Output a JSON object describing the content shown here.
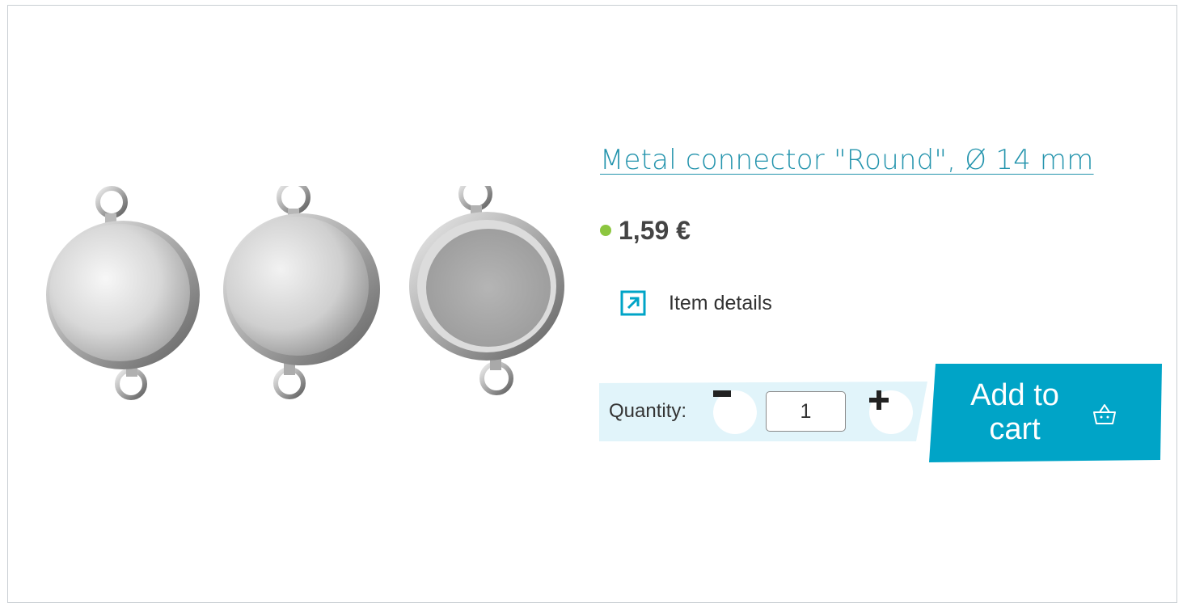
{
  "product": {
    "title": "Metal connector \"Round\", Ø 14 mm",
    "price": "1,59 €",
    "details_label": "Item details",
    "image_alt": "Metal connectors round silver"
  },
  "order": {
    "quantity_label": "Quantity:",
    "quantity_value": "1",
    "add_to_cart_label": "Add to cart"
  },
  "colors": {
    "accent": "#00a4c7",
    "link": "#2494ad",
    "stock_dot": "#8cc63f",
    "qty_band": "#e1f4fa"
  },
  "icons": {
    "details": "arrow-up-right-icon",
    "cart": "basket-icon",
    "minus": "minus-icon",
    "plus": "plus-icon",
    "stock": "in-stock-dot"
  }
}
